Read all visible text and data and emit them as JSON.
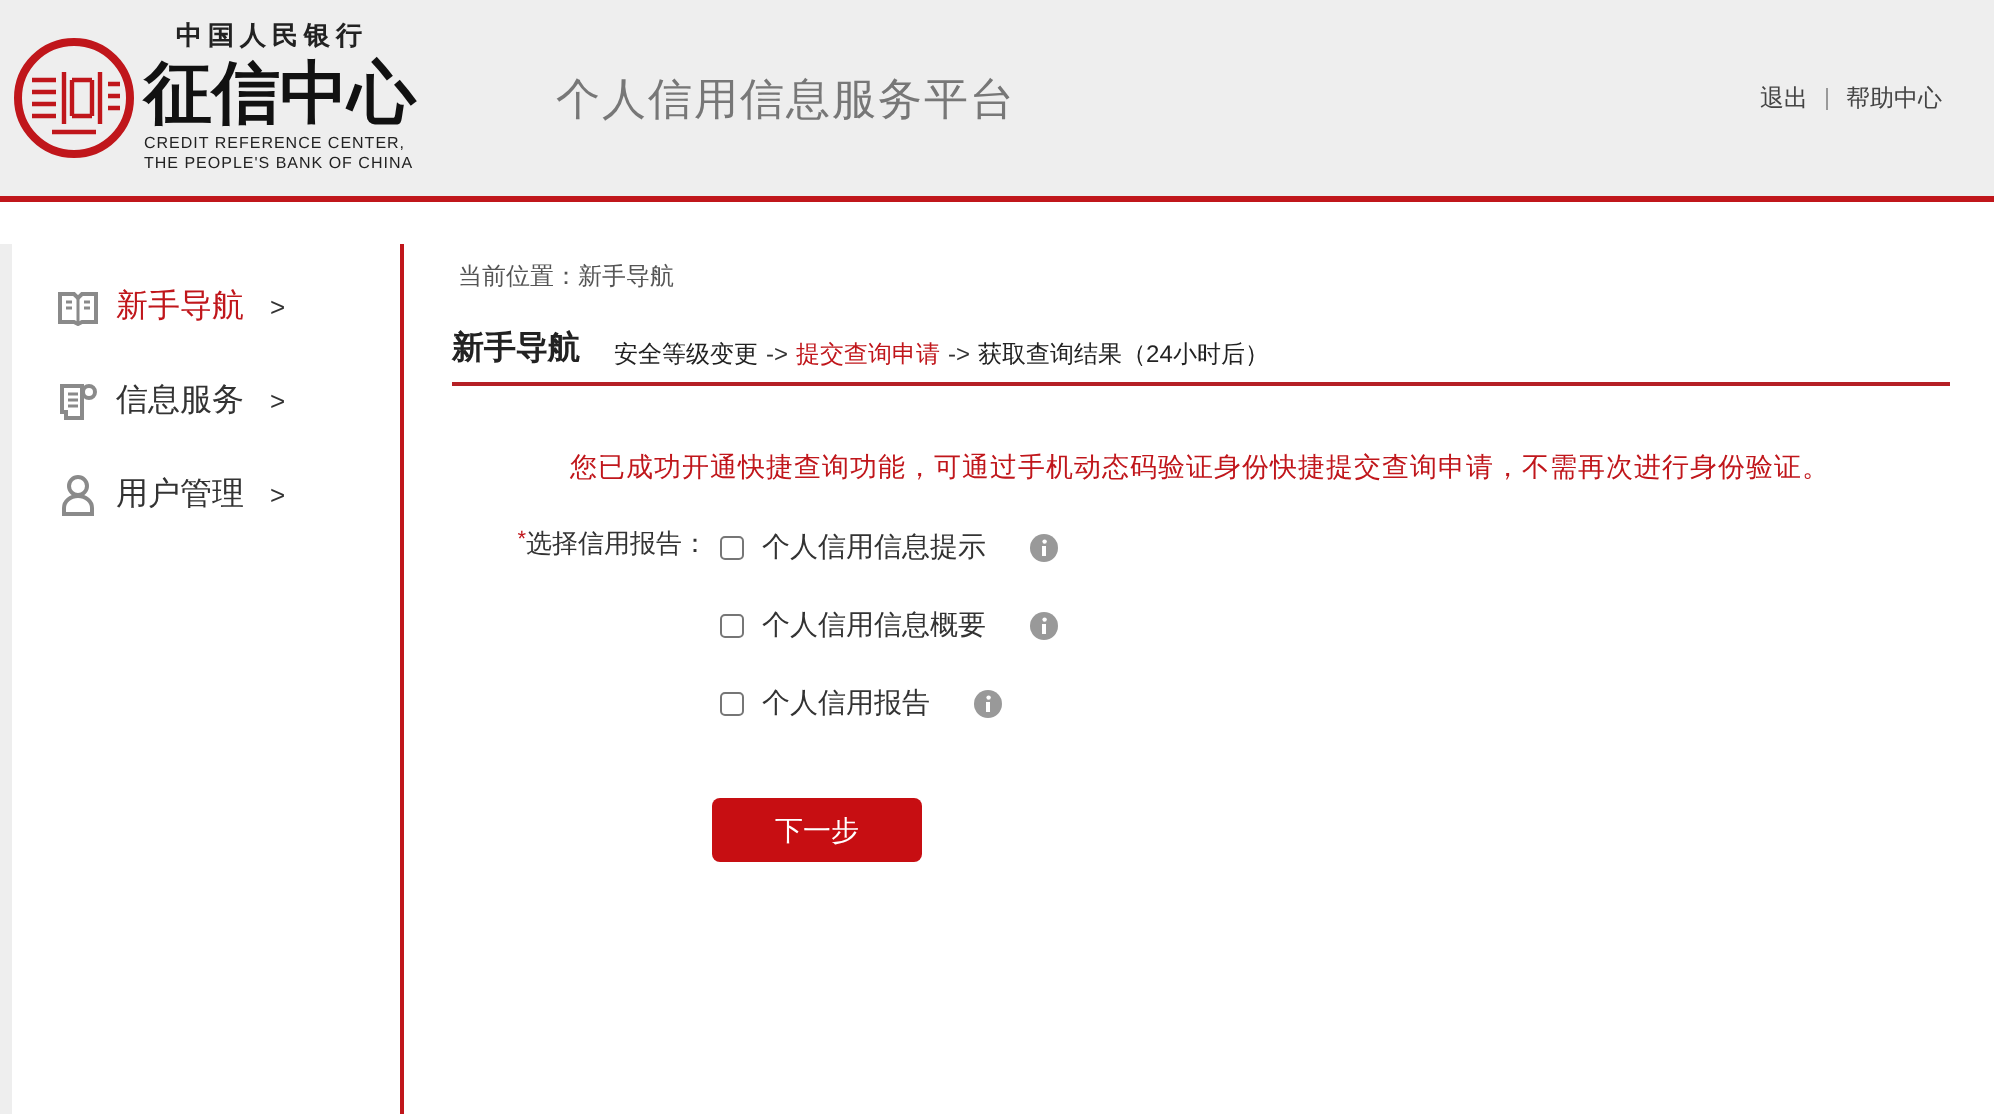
{
  "header": {
    "logo": {
      "top_line": "中国人民银行",
      "name": "征信中心",
      "english_lines": [
        "CREDIT REFERENCE CENTER,",
        "THE PEOPLE'S BANK OF CHINA"
      ]
    },
    "title": "个人信用信息服务平台",
    "links": [
      "退出",
      "帮助中心"
    ]
  },
  "sidebar": {
    "items": [
      {
        "label": "新手导航",
        "kind": "book",
        "selected": true,
        "chevron": ">"
      },
      {
        "label": "信息服务",
        "kind": "document",
        "selected": false,
        "chevron": ">"
      },
      {
        "label": "用户管理",
        "kind": "user",
        "selected": false,
        "chevron": ">"
      }
    ]
  },
  "breadcrumb": "当前位置：新手导航",
  "section": {
    "title": "新手导航",
    "steps": [
      {
        "label": "安全等级变更",
        "selected": false
      },
      {
        "label": "提交查询申请",
        "selected": true
      },
      {
        "label": "获取查询结果（24小时后）",
        "selected": false
      }
    ],
    "separator": "->"
  },
  "notice": "您已成功开通快捷查询功能，可通过手机动态码验证身份快捷提交查询申请，不需再次进行身份验证。",
  "form": {
    "required_mark": "*",
    "label": "选择信用报告：",
    "options": [
      {
        "label": "个人信用信息提示",
        "checked": false
      },
      {
        "label": "个人信用信息概要",
        "checked": false
      },
      {
        "label": "个人信用报告",
        "checked": false
      }
    ],
    "submit": "下一步"
  }
}
